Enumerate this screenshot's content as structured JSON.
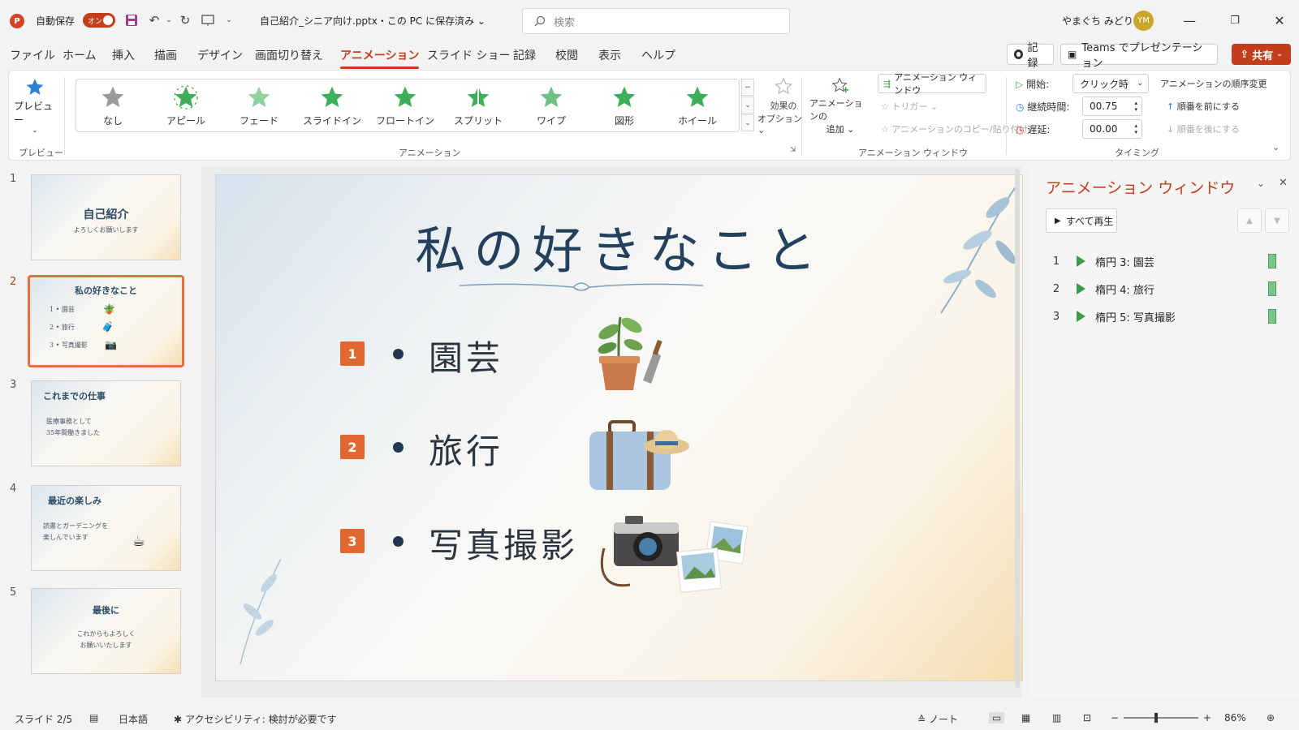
{
  "titlebar": {
    "logo": "P",
    "autosave_label": "自動保存",
    "autosave_state": "オン",
    "doc_title": "自己紹介_シニア向け.pptx・この PC に保存済み ⌄",
    "search_placeholder": "検索",
    "user_name": "やまぐち みどり",
    "avatar_initials": "YM"
  },
  "tabs": [
    "ファイル",
    "ホーム",
    "挿入",
    "描画",
    "デザイン",
    "画面切り替え",
    "アニメーション",
    "スライド ショー",
    "記録",
    "校閲",
    "表示",
    "ヘルプ"
  ],
  "active_tab": "アニメーション",
  "tab_actions": {
    "record": "記録",
    "teams": "Teams でプレゼンテーション",
    "share": "共有"
  },
  "ribbon": {
    "preview_button": "プレビュー",
    "preview_group": "プレビュー",
    "gallery": [
      "なし",
      "アピール",
      "フェード",
      "スライドイン",
      "フロートイン",
      "スプリット",
      "ワイプ",
      "図形",
      "ホイール"
    ],
    "effect_options": [
      "効果の",
      "オプション ⌄"
    ],
    "animation_group": "アニメーション",
    "add_animation": [
      "アニメーションの",
      "追加 ⌄"
    ],
    "animation_pane_btn": "アニメーション ウィンドウ",
    "trigger": "トリガー ⌄",
    "painter": "アニメーションのコピー/貼り付け",
    "advanced_group": "アニメーション ウィンドウ",
    "start_label": "開始:",
    "start_value": "クリック時",
    "duration_label": "継続時間:",
    "duration_value": "00.75",
    "delay_label": "遅延:",
    "delay_value": "00.00",
    "reorder_label": "アニメーションの順序変更",
    "move_earlier": "順番を前にする",
    "move_later": "順番を後にする",
    "timing_group": "タイミング"
  },
  "thumbnails": [
    {
      "num": "1",
      "title": "自己紹介",
      "sub": "よろしくお願いします"
    },
    {
      "num": "2",
      "title": "私の好きなこと",
      "items": [
        "1 • 園芸",
        "2 • 旅行",
        "3 • 写真撮影"
      ]
    },
    {
      "num": "3",
      "title": "これまでの仕事",
      "sub1": "医療事務として",
      "sub2": "35年間働きました"
    },
    {
      "num": "4",
      "title": "最近の楽しみ",
      "sub1": "読書とガーデニングを",
      "sub2": "楽しんでいます"
    },
    {
      "num": "5",
      "title": "最後に",
      "sub1": "これからもよろしく",
      "sub2": "お願いいたします"
    }
  ],
  "slide": {
    "title": "私の好きなこと",
    "bullets": [
      {
        "num": "1",
        "text": "園芸"
      },
      {
        "num": "2",
        "text": "旅行"
      },
      {
        "num": "3",
        "text": "写真撮影"
      }
    ]
  },
  "pane": {
    "title": "アニメーション ウィンドウ",
    "play_all": "すべて再生",
    "items": [
      {
        "idx": "1",
        "label": "楕円 3: 園芸"
      },
      {
        "idx": "2",
        "label": "楕円 4: 旅行"
      },
      {
        "idx": "3",
        "label": "楕円 5: 写真撮影"
      }
    ]
  },
  "status": {
    "slide_info": "スライド 2/5",
    "language": "日本語",
    "accessibility": "アクセシビリティ: 検討が必要です",
    "notes": "ノート",
    "zoom": "86%"
  },
  "colors": {
    "accent": "#c43e1c",
    "anim_green": "#3b9b4a",
    "bullet_orange": "#e2662f",
    "title_navy": "#23405c"
  }
}
